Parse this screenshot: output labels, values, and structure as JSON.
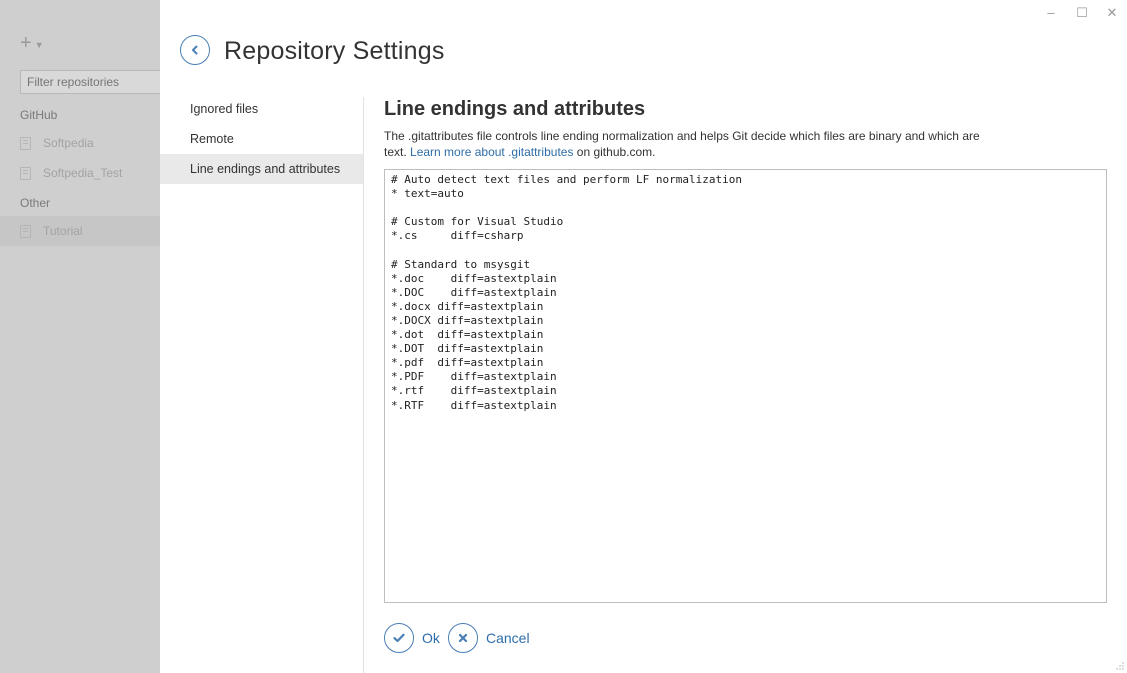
{
  "sidebar": {
    "add_icon": "plus-icon",
    "filter_placeholder": "Filter repositories",
    "groups": [
      {
        "label": "GitHub",
        "repos": [
          "Softpedia",
          "Softpedia_Test"
        ]
      },
      {
        "label": "Other",
        "repos": [
          "Tutorial"
        ]
      }
    ],
    "selected_repo": "Tutorial"
  },
  "window_controls": {
    "minimize": "–",
    "maximize": "☐",
    "close": "✕"
  },
  "header": {
    "back_icon": "chevron-left-icon",
    "title": "Repository Settings"
  },
  "nav": {
    "items": [
      "Ignored files",
      "Remote",
      "Line endings and attributes"
    ],
    "active": "Line endings and attributes"
  },
  "content": {
    "title": "Line endings and attributes",
    "desc_before": "The .gitattributes file controls line ending normalization and helps Git decide which files are binary and which are text. ",
    "desc_link": "Learn more about .gitattributes",
    "desc_after": " on github.com.",
    "editor_text": "# Auto detect text files and perform LF normalization\n* text=auto\n\n# Custom for Visual Studio\n*.cs     diff=csharp\n\n# Standard to msysgit\n*.doc    diff=astextplain\n*.DOC    diff=astextplain\n*.docx diff=astextplain\n*.DOCX diff=astextplain\n*.dot  diff=astextplain\n*.DOT  diff=astextplain\n*.pdf  diff=astextplain\n*.PDF    diff=astextplain\n*.rtf    diff=astextplain\n*.RTF    diff=astextplain"
  },
  "footer": {
    "ok_label": "Ok",
    "cancel_label": "Cancel"
  },
  "colors": {
    "accent": "#4a7fb5",
    "link": "#2e6da8",
    "sidebar_dim": "#cfcfcf"
  }
}
